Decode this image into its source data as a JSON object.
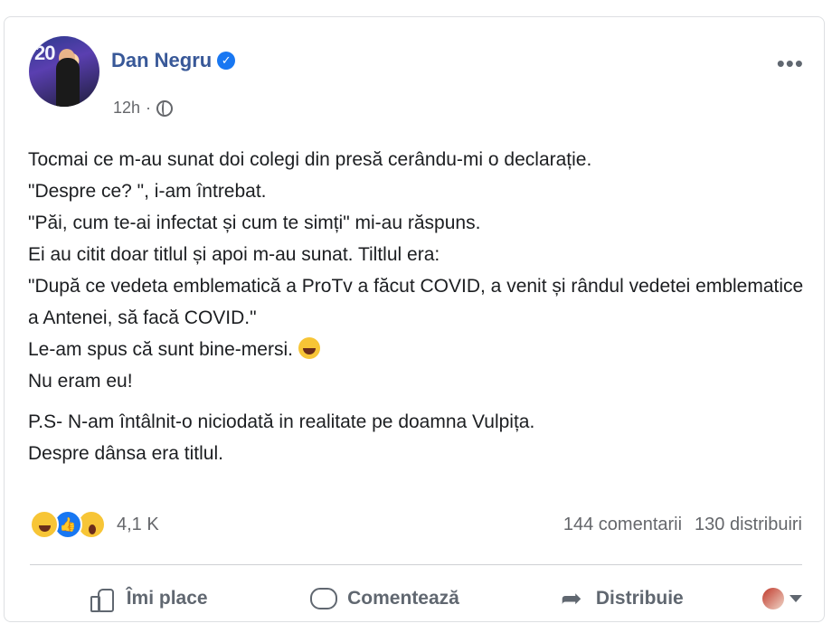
{
  "post": {
    "author": "Dan Negru",
    "time": "12h",
    "separator": "·",
    "avatar_text": "20",
    "paragraphs": [
      "Tocmai ce m-au sunat doi colegi din presă cerându-mi o declarație.",
      "\"Despre ce? \", i-am întrebat.",
      "\"Păi, cum te-ai infectat și cum te simți\" mi-au răspuns.",
      "Ei au citit doar titlul și apoi m-au sunat. Tiltlul era:",
      "\"După ce vedeta emblematică a ProTv a făcut COVID, a venit și rândul vedetei emblematice a Antenei, să facă COVID.\"",
      "Le-am spus că sunt bine-mersi.",
      "Nu eram eu!"
    ],
    "ps": [
      "P.S- N-am întâlnit-o niciodată in realitate pe doamna Vulpița.",
      "Despre dânsa era titlul."
    ]
  },
  "stats": {
    "reactions_count": "4,1 K",
    "comments": "144 comentarii",
    "shares": "130 distribuiri"
  },
  "actions": {
    "like": "Îmi place",
    "comment": "Comentează",
    "share": "Distribuie"
  },
  "icons": {
    "verified": "verified-badge-icon",
    "audience": "globe-icon",
    "more": "more-options-icon",
    "like": "thumbs-up-icon",
    "comment": "speech-bubble-icon",
    "share": "share-arrow-icon",
    "reactions": [
      "haha-icon",
      "like-icon",
      "wow-icon"
    ],
    "emoji_in_text": "laughing-emoji-icon"
  },
  "colors": {
    "author": "#385898",
    "verified": "#1877f2",
    "muted": "#65676b",
    "divider": "#ced0d4"
  }
}
